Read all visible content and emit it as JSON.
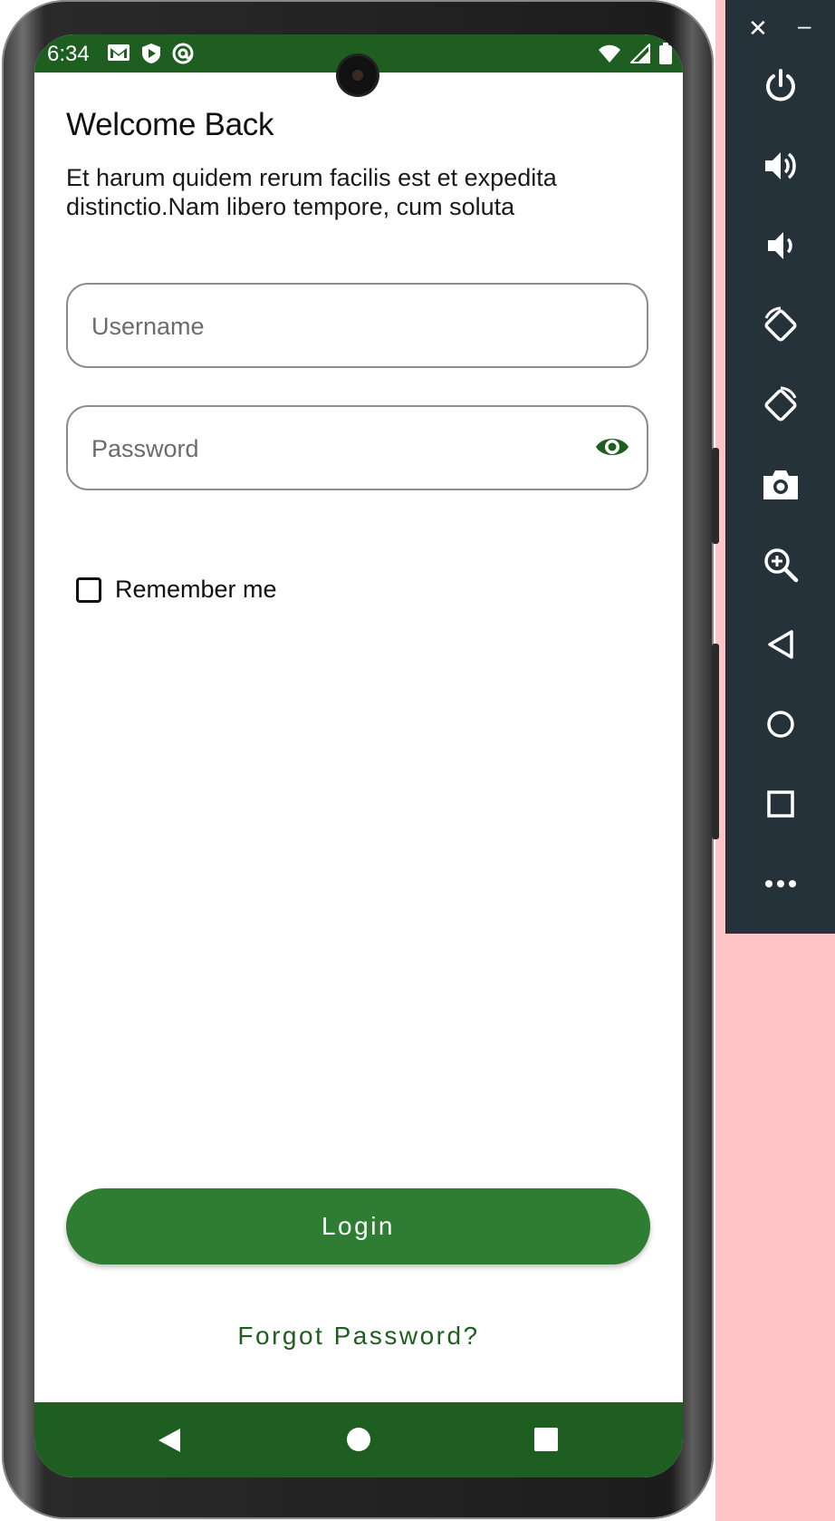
{
  "status_bar": {
    "time": "6:34",
    "left_icons": [
      "gmail-icon",
      "shield-play-icon",
      "at-sync-icon"
    ],
    "right_icons": [
      "wifi-icon",
      "signal-icon",
      "battery-icon"
    ],
    "color": "#1e5e20"
  },
  "login_screen": {
    "title": "Welcome Back",
    "subtitle": "Et harum quidem rerum facilis est et expedita distinctio.Nam libero tempore, cum soluta",
    "username_placeholder": "Username",
    "password_placeholder": "Password",
    "remember_label": "Remember me",
    "remember_checked": false,
    "login_label": "Login",
    "forgot_label": "Forgot Password?",
    "accent_color": "#2e7d32"
  },
  "nav_bar": {
    "buttons": [
      "back-icon",
      "home-icon",
      "recents-icon"
    ]
  },
  "emulator_panel": {
    "close_label": "✕",
    "minimize_label": "–",
    "buttons": [
      "power-icon",
      "volume-up-icon",
      "volume-down-icon",
      "rotate-left-icon",
      "rotate-right-icon",
      "screenshot-icon",
      "zoom-icon",
      "back-icon",
      "home-icon",
      "overview-icon",
      "more-icon"
    ]
  }
}
